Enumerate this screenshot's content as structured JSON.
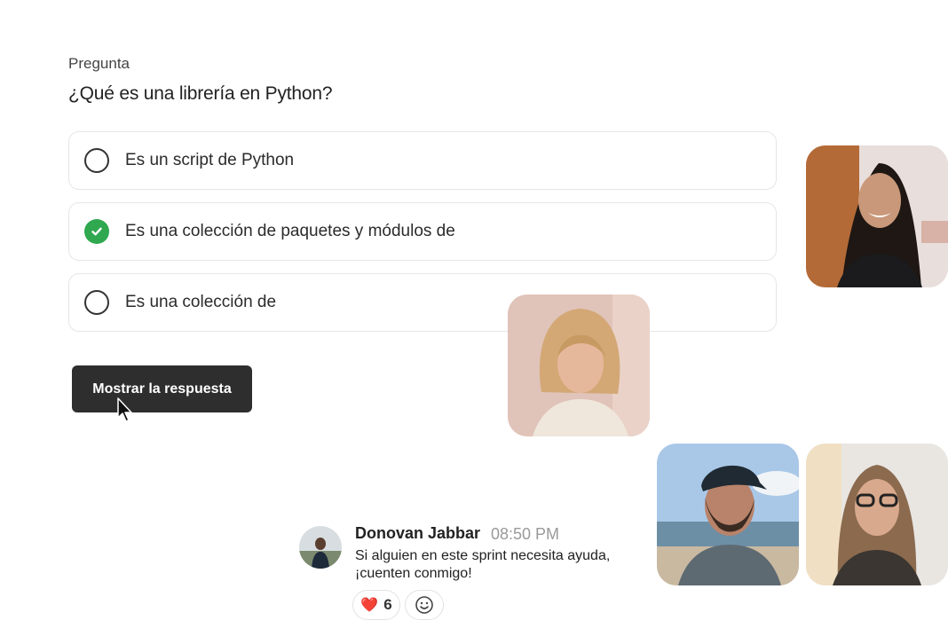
{
  "question": {
    "label": "Pregunta",
    "title": "¿Qué es una librería en Python?",
    "options": [
      {
        "text": "Es un script de Python",
        "selected": false
      },
      {
        "text": "Es una colección de paquetes y módulos de",
        "selected": true
      },
      {
        "text": "Es una colección de",
        "selected": false
      }
    ],
    "reveal_button": "Mostrar la respuesta"
  },
  "colors": {
    "accent_green": "#2fa84f",
    "button_dark": "#2e2e2e"
  },
  "chat": {
    "author": "Donovan Jabbar",
    "time": "08:50 PM",
    "message": "Si alguien en este sprint necesita ayuda, ¡cuenten conmigo!",
    "reactions": [
      {
        "icon": "heart-icon",
        "emoji": "❤️",
        "count": "6"
      },
      {
        "icon": "add-reaction-icon"
      }
    ]
  }
}
